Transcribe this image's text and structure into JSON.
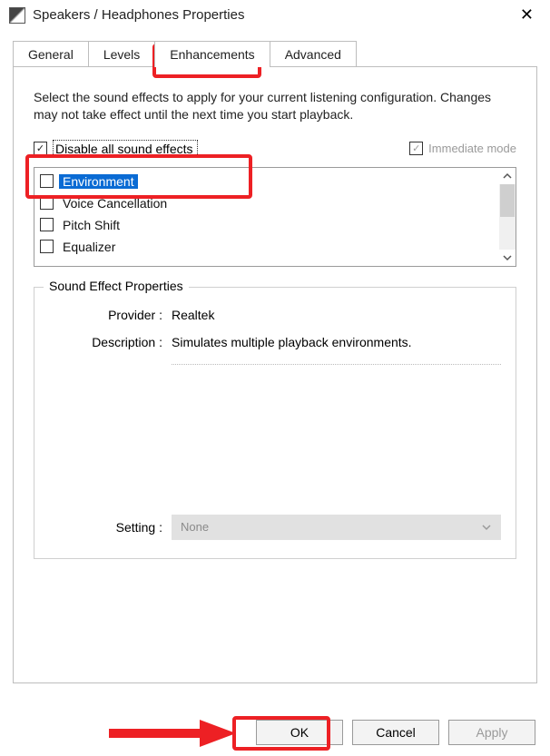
{
  "window": {
    "title": "Speakers / Headphones Properties",
    "close_glyph": "✕"
  },
  "tabs": {
    "general": "General",
    "levels": "Levels",
    "enhancements": "Enhancements",
    "advanced": "Advanced"
  },
  "instructions": "Select the sound effects to apply for your current listening configuration. Changes may not take effect until the next time you start playback.",
  "controls": {
    "disable_all_label": "Disable all sound effects",
    "immediate_label": "Immediate mode"
  },
  "effects": [
    {
      "label": "Environment",
      "selected": true
    },
    {
      "label": "Voice Cancellation",
      "selected": false
    },
    {
      "label": "Pitch Shift",
      "selected": false
    },
    {
      "label": "Equalizer",
      "selected": false
    }
  ],
  "fieldset": {
    "legend": "Sound Effect Properties",
    "provider_label": "Provider :",
    "provider_value": "Realtek",
    "description_label": "Description :",
    "description_value": "Simulates multiple playback environments.",
    "setting_label": "Setting :",
    "setting_value": "None"
  },
  "buttons": {
    "ok": "OK",
    "cancel": "Cancel",
    "apply": "Apply"
  }
}
